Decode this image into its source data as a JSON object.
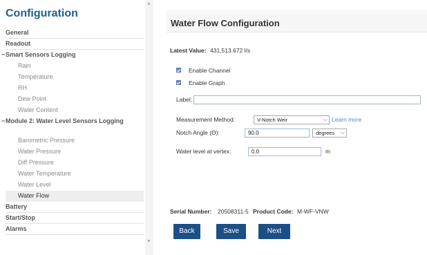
{
  "sidebar": {
    "title": "Configuration",
    "items": {
      "general": "General",
      "readout": "Readout",
      "smart_group": "Smart Sensors Logging",
      "rain": "Rain",
      "temperature": "Temperature",
      "rh": "RH",
      "dew_point": "Dew Point",
      "water_content": "Water Content",
      "module2_group": "Module 2: Water Level Sensors Logging",
      "barometric": "Barometric Pressure",
      "water_pressure": "Water Pressure",
      "diff_pressure": "Diff Pressure",
      "water_temperature": "Water Temperature",
      "water_level": "Water Level",
      "water_flow": "Water Flow",
      "battery": "Battery",
      "start_stop": "Start/Stop",
      "alarms": "Alarms"
    }
  },
  "panel": {
    "title": "Water Flow Configuration",
    "latest_label": "Latest Value:",
    "latest_value": "431,513.672 l/s",
    "enable_channel": "Enable Channel",
    "enable_graph": "Enable Graph",
    "label_label": "Label:",
    "label_value": "",
    "method_label": "Measurement Method:",
    "method_value": "V-Notch Weir",
    "learn_more": "Learn more",
    "notch_label": "Notch Angle (Θ):",
    "notch_value": "90.0",
    "notch_unit": "degrees",
    "vertex_label": "Water level at vertex:",
    "vertex_value": "0.0",
    "vertex_unit": "m",
    "serial_label": "Serial Number:",
    "serial_value": "20508311-5",
    "product_label": "Product Code:",
    "product_value": "M-WF-VNW"
  },
  "buttons": {
    "back": "Back",
    "save": "Save",
    "next": "Next"
  },
  "colors": {
    "accent": "#1f5f8f",
    "button": "#1d4f86",
    "link": "#4a89c8"
  }
}
